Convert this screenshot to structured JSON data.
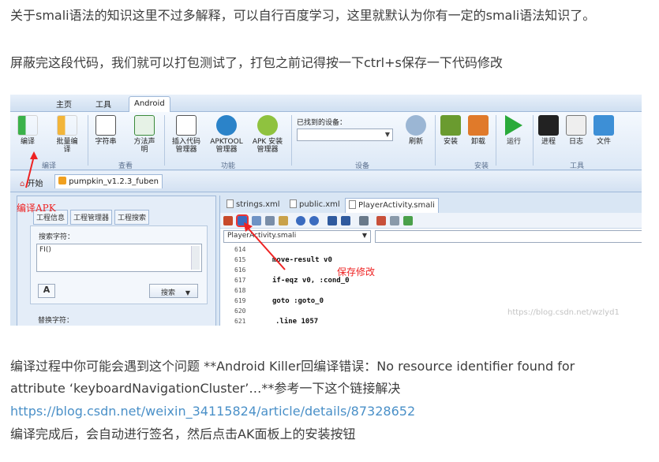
{
  "article": {
    "para1": "关于smali语法的知识这里不过多解释，可以自行百度学习，这里就默认为你有一定的smali语法知识了。",
    "para2": "屏蔽完这段代码，我们就可以打包测试了，打包之前记得按一下ctrl+s保存一下代码修改",
    "para3": "编译过程中你可能会遇到这个问题 **Android Killer回编译错误：No resource identifier found for attribute ‘keyboardNavigationCluster’…**参考一下这个链接解决",
    "link": "https://blog.csdn.net/weixin_34115824/article/details/87328652",
    "para5": "编译完成后，会自动进行签名，然后点击AK面板上的安装按钮"
  },
  "screenshot": {
    "tabs": [
      "主页",
      "工具",
      "Android"
    ],
    "ribbon": {
      "compile": "编译",
      "batch_compile": "批量编\n译",
      "strings": "字符串",
      "method_sig": "方法声\n明",
      "insert_code": "插入代码\n管理器",
      "apktool": "APKTOOL\n管理器",
      "apk_install": "APK 安装\n管理器",
      "device_label": "已找到的设备：",
      "refresh": "刷新",
      "install": "安装",
      "uninstall": "卸载",
      "run": "运行",
      "process": "进程",
      "log": "日志",
      "file": "文件",
      "groups": {
        "compile": "编译",
        "view": "查看",
        "function": "功能",
        "device": "设备",
        "install": "安装",
        "tools": "工具"
      }
    },
    "project_tabs": {
      "start": "开始",
      "project": "pumpkin_v1.2.3_fuben"
    },
    "left_tabs": [
      "工程信息",
      "工程管理器",
      "工程搜索"
    ],
    "search_label": "搜索字符：",
    "search_value": "FI()",
    "search_button": "搜索",
    "replace_label": "替换字符：",
    "editor_tabs": [
      "strings.xml",
      "public.xml",
      "PlayerActivity.smali"
    ],
    "class_select": "PlayerActivity.smali",
    "code_lines": [
      {
        "n": "614",
        "code": ""
      },
      {
        "n": "615",
        "code": "move-result v0"
      },
      {
        "n": "616",
        "code": ""
      },
      {
        "n": "617",
        "code": "if-eqz v0, :cond_0"
      },
      {
        "n": "618",
        "code": ""
      },
      {
        "n": "619",
        "code": "goto :goto_0"
      },
      {
        "n": "620",
        "code": ""
      },
      {
        "n": "621",
        "code": ".line 1057"
      }
    ],
    "annotation_compile": "编译APK",
    "annotation_save": "保存修改",
    "watermark": "https://blog.csdn.net/wzlyd1"
  }
}
